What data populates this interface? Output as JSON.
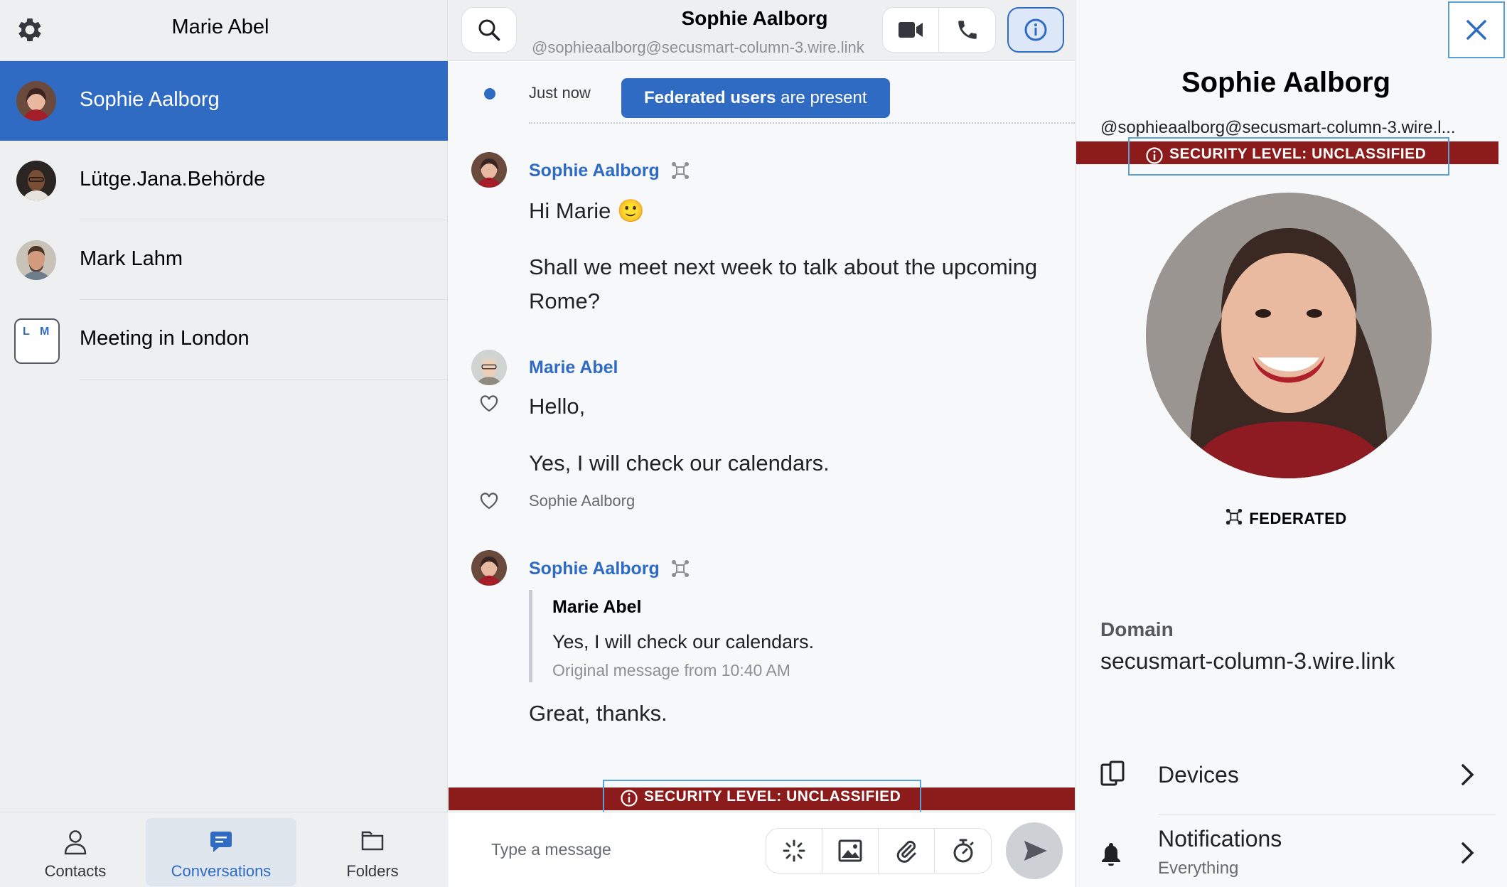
{
  "left": {
    "user_name": "Marie Abel",
    "conversations": [
      {
        "name": "Sophie Aalborg",
        "active": true
      },
      {
        "name": "Lütge.Jana.Behörde",
        "active": false
      },
      {
        "name": "Mark Lahm",
        "active": false
      },
      {
        "name": "Meeting in London",
        "active": false,
        "initials": [
          "L",
          "M"
        ]
      }
    ],
    "nav": {
      "contacts": "Contacts",
      "conversations": "Conversations",
      "folders": "Folders"
    }
  },
  "center": {
    "title": "Sophie Aalborg",
    "handle": "@sophieaalborg@secusmart-column-3.wire.link",
    "timestamp": "Just now",
    "federated_bold": "Federated users",
    "federated_rest": " are present",
    "messages": [
      {
        "sender": "Sophie Aalborg",
        "lines": [
          "Hi Marie 🙂",
          "Shall we meet next week to talk about the upcoming",
          "Rome?"
        ]
      },
      {
        "sender": "Marie Abel",
        "lines": [
          "Hello,",
          "Yes, I will check our calendars."
        ],
        "liked_by": "Sophie Aalborg"
      },
      {
        "sender": "Sophie Aalborg",
        "quote": {
          "author": "Marie Abel",
          "text": "Yes, I will check our calendars.",
          "meta": "Original message from 10:40 AM"
        },
        "lines": [
          "Great, thanks."
        ]
      }
    ],
    "security_level": "SECURITY LEVEL: UNCLASSIFIED",
    "composer_placeholder": "Type a message"
  },
  "right": {
    "name": "Sophie Aalborg",
    "handle": "@sophieaalborg@secusmart-column-3.wire.l...",
    "security_level": "SECURITY LEVEL: UNCLASSIFIED",
    "federated": "FEDERATED",
    "domain_label": "Domain",
    "domain_value": "secusmart-column-3.wire.link",
    "devices": "Devices",
    "notifications": "Notifications",
    "notifications_value": "Everything"
  },
  "colors": {
    "accent": "#2f6bc3",
    "security_bar": "#8c1c1c",
    "highlight_box": "#5aa0d8"
  }
}
